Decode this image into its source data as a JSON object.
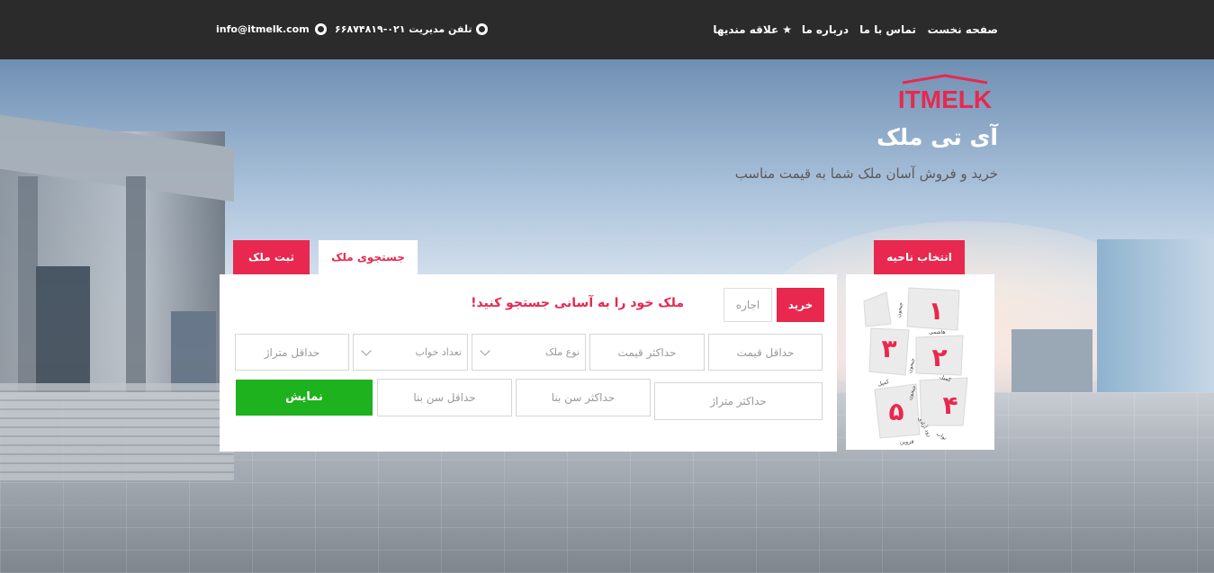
{
  "nav": {
    "home": "صفحه نخست",
    "contact": "تماس با ما",
    "about": "درباره ما",
    "favorites": "علاقه مندیها"
  },
  "contact": {
    "phone": "تلفن مدیریت ۰۲۱-۶۶۸۷۴۸۱۹",
    "email": "info@itmelk.com"
  },
  "brand": {
    "logo_text": "ITMELK",
    "site_name": "آی تی ملک",
    "tagline": "خرید و فروش آسان ملک شما به قیمت مناسب",
    "accent_color": "#e8284f"
  },
  "tabs": {
    "region": "انتخاب ناحیه",
    "search": "جستجوی ملک",
    "register": "ثبت ملک"
  },
  "search": {
    "buy": "خرید",
    "rent": "اجاره",
    "heading": "ملک خود را به آسانی جستجو کنید!",
    "min_price": "حداقل قیمت",
    "max_price": "حداکثر قیمت",
    "property_type": "نوع ملک",
    "bedrooms": "تعداد خواب",
    "min_area": "حداقل متراژ",
    "max_area": "حداکثر متراژ",
    "max_age": "حداکثر سن بنا",
    "min_age": "حداقل سن بنا",
    "show": "نمایش",
    "show_color": "#1eb21e"
  },
  "map": {
    "zones": [
      "۱",
      "۲",
      "۳",
      "۴",
      "۵"
    ],
    "streets": [
      "هاشمی",
      "جیحون",
      "جیحون",
      "کمیل",
      "کمیل",
      "نواب",
      "قزوین",
      "جیحون",
      "رود آزادی"
    ]
  }
}
